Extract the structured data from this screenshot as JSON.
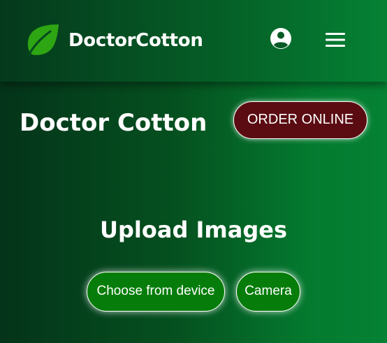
{
  "header": {
    "brand_name": "DoctorCotton",
    "logo_icon": "leaf-icon",
    "account_icon": "account-circle-icon",
    "menu_icon": "hamburger-menu-icon"
  },
  "main": {
    "title": "Doctor Cotton",
    "order_button_label": "ORDER ONLINE",
    "upload_heading": "Upload Images",
    "choose_button_label": "Choose from device",
    "camera_button_label": "Camera"
  },
  "colors": {
    "background_dark": "#04341a",
    "background_light": "#058234",
    "leaf_green": "#2ea512",
    "order_button": "#5a0c12",
    "action_button": "#067d0a",
    "text": "#ffffff"
  }
}
